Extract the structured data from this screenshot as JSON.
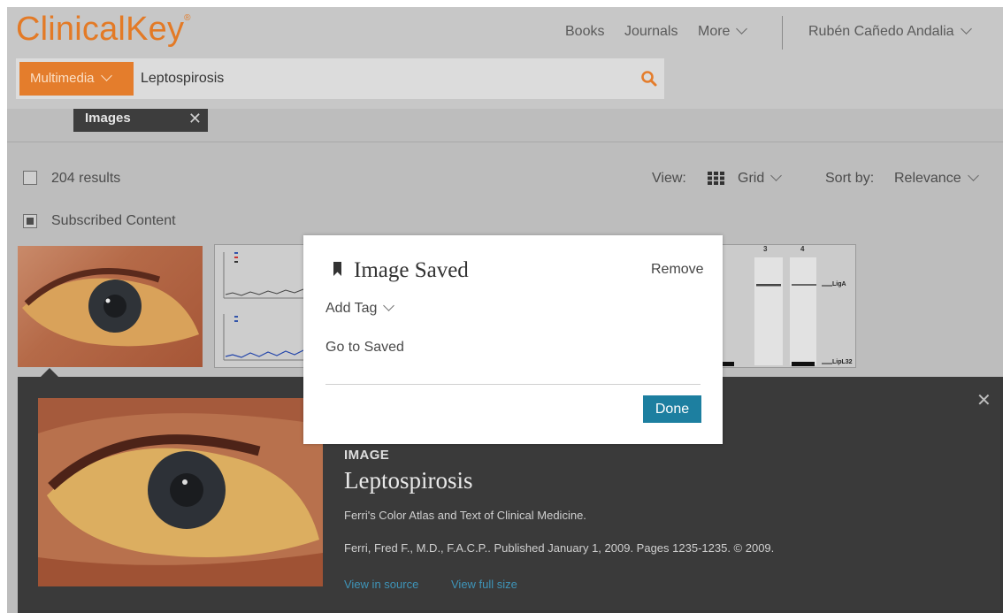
{
  "header": {
    "logo": "ClinicalKey",
    "logo_mark": "®",
    "nav": {
      "books": "Books",
      "journals": "Journals",
      "more": "More"
    },
    "user_name": "Rubén Cañedo Andalia"
  },
  "search": {
    "scope": "Multimedia",
    "query": "Leptospirosis",
    "icon": "search-icon",
    "accent": "#e47d2c"
  },
  "filter": {
    "label": "Images",
    "remove": "✕"
  },
  "results": {
    "count": "204 results",
    "view_label": "View:",
    "view_value": "Grid",
    "sort_label": "Sort by:",
    "sort_value": "Relevance",
    "subscribed": "Subscribed Content"
  },
  "thumbnails": {
    "blot_lanes": [
      "3",
      "4"
    ],
    "blot_labels": [
      "LigA",
      "LipL32"
    ]
  },
  "detail": {
    "close": "✕",
    "kind": "IMAGE",
    "title": "Leptospirosis",
    "source": "Ferri's Color Atlas and Text of Clinical Medicine.",
    "citation": "Ferri, Fred F., M.D., F.A.C.P.. Published January 1, 2009. Pages 1235-1235. © 2009.",
    "link_source": "View in source",
    "link_full": "View full size"
  },
  "modal": {
    "title": "Image Saved",
    "remove": "Remove",
    "add_tag": "Add Tag",
    "go_saved": "Go to Saved",
    "done": "Done",
    "done_color": "#1d7fa0"
  }
}
